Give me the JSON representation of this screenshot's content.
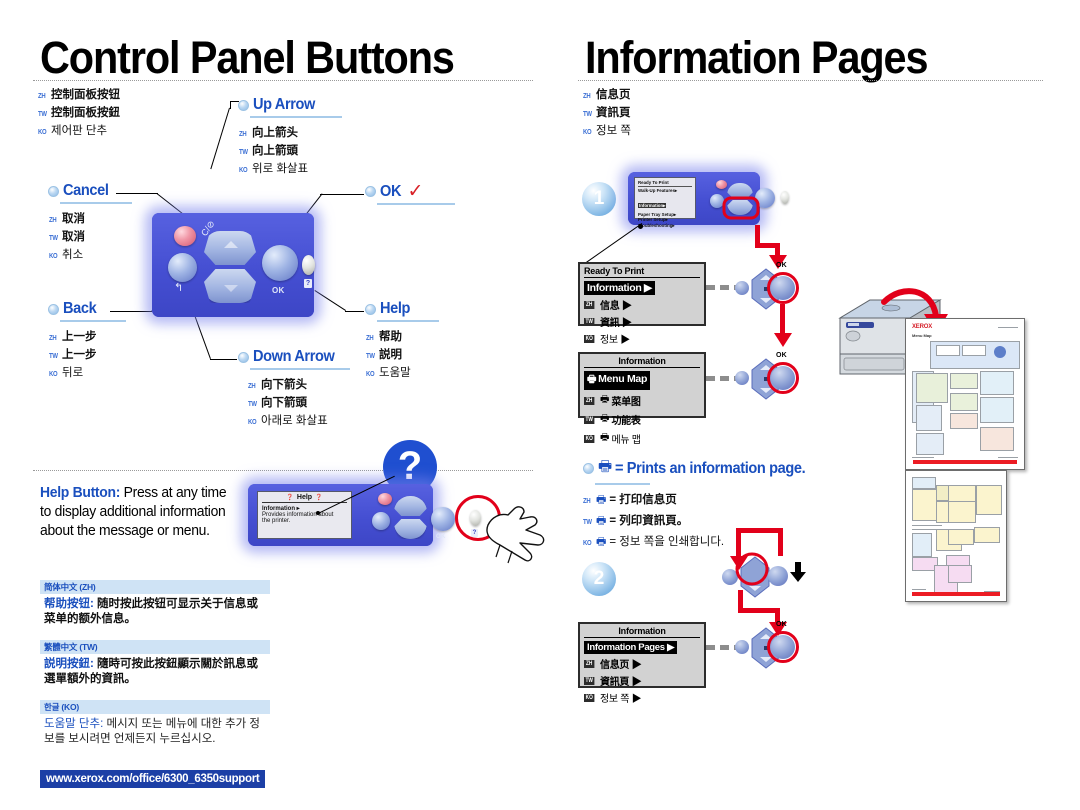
{
  "left_panel": {
    "heading": "Control Panel Buttons",
    "heading_langs": [
      {
        "tag": "ZH",
        "text": "控制面板按钮"
      },
      {
        "tag": "TW",
        "text": "控制面板按鈕"
      },
      {
        "tag": "KO",
        "text": "제어판 단추"
      }
    ],
    "callouts": [
      {
        "id": "up-arrow",
        "label": "Up Arrow",
        "check": false,
        "langs": [
          {
            "tag": "ZH",
            "text": "向上箭头"
          },
          {
            "tag": "TW",
            "text": "向上箭頭"
          },
          {
            "tag": "KO",
            "text": "위로 화살표"
          }
        ]
      },
      {
        "id": "cancel",
        "label": "Cancel",
        "check": false,
        "langs": [
          {
            "tag": "ZH",
            "text": "取消"
          },
          {
            "tag": "TW",
            "text": "取消"
          },
          {
            "tag": "KO",
            "text": "취소"
          }
        ]
      },
      {
        "id": "ok",
        "label": "OK",
        "check": true,
        "check_glyph": "✓",
        "langs": []
      },
      {
        "id": "back",
        "label": "Back",
        "check": false,
        "langs": [
          {
            "tag": "ZH",
            "text": "上一步"
          },
          {
            "tag": "TW",
            "text": "上一步"
          },
          {
            "tag": "KO",
            "text": "뒤로"
          }
        ]
      },
      {
        "id": "help",
        "label": "Help",
        "check": false,
        "langs": [
          {
            "tag": "ZH",
            "text": "帮助"
          },
          {
            "tag": "TW",
            "text": "説明"
          },
          {
            "tag": "KO",
            "text": "도움말"
          }
        ]
      },
      {
        "id": "down-arrow",
        "label": "Down Arrow",
        "check": false,
        "langs": [
          {
            "tag": "ZH",
            "text": "向下箭头"
          },
          {
            "tag": "TW",
            "text": "向下箭頭"
          },
          {
            "tag": "KO",
            "text": "아래로 화살표"
          }
        ]
      }
    ],
    "control_panel_art": {
      "ok_label": "OK",
      "back_glyph": "↰",
      "cancel_glyph": "C/⊘",
      "help_glyph": "?"
    },
    "help_note": {
      "bold": "Help Button:",
      "rest": " Press at any time to display additional information about the message or menu.",
      "icon": "?"
    },
    "help_lcd": {
      "title": "Help",
      "title_icon": "?",
      "line1": "Information ▸",
      "line2": "Provides information about",
      "line3": "the printer."
    },
    "lang_boxes": [
      {
        "id": "zh",
        "header": "简体中文 (ZH)",
        "lead": "帮助按钮:",
        "body": "随时按此按钮可显示关于信息或菜单的额外信息。"
      },
      {
        "id": "tw",
        "header": "繁體中文 (TW)",
        "lead": "説明按鈕:",
        "body": "隨時可按此按鈕顯示關於訊息或選單額外的資訊。"
      },
      {
        "id": "ko",
        "header": "한글 (KO)",
        "lead": "도움말 단추:",
        "body": "메시지 또는 메뉴에 대한 추가 정보를 보시려면 언제든지 누르십시오."
      }
    ],
    "url": "www.xerox.com/office/6300_6350support"
  },
  "right_panel": {
    "heading": "Information Pages",
    "heading_langs": [
      {
        "tag": "ZH",
        "text": "信息页"
      },
      {
        "tag": "TW",
        "text": "資訊頁"
      },
      {
        "tag": "KO",
        "text": "정보 쪽"
      }
    ],
    "step1": {
      "number": "1",
      "mini_lcd": [
        "Ready To Print",
        "Walk-Up Features▸",
        "Information▸",
        "Paper Tray Setup▸",
        "Printer Setup▸",
        "Troubleshooting▸"
      ],
      "lcd_a": {
        "title": "Ready To Print",
        "highlight": "Information ▶",
        "rows": [
          {
            "tag": "ZH",
            "text": "信息 ▶"
          },
          {
            "tag": "TW",
            "text": "資訊 ▶"
          },
          {
            "tag": "KO",
            "text": "정보 ▶"
          }
        ]
      },
      "lcd_b": {
        "title": "Information",
        "highlight": "Menu Map",
        "highlight_icon": "printer",
        "rows": [
          {
            "tag": "ZH",
            "text": "菜单图",
            "icon": "printer"
          },
          {
            "tag": "TW",
            "text": "功能表",
            "icon": "printer"
          },
          {
            "tag": "KO",
            "text": "메뉴 맵",
            "icon": "printer"
          }
        ]
      },
      "ok_cap": "OK"
    },
    "legend": {
      "icon": "printer",
      "label": "= Prints an information page.",
      "langs": [
        {
          "tag": "ZH",
          "text": "= 打印信息页"
        },
        {
          "tag": "TW",
          "text": "= 列印資訊頁。"
        },
        {
          "tag": "KO",
          "text": "= 정보 쪽을 인쇄합니다."
        }
      ]
    },
    "step2": {
      "number": "2",
      "lcd": {
        "title": "Information",
        "highlight": "Information Pages ▶",
        "rows": [
          {
            "tag": "ZH",
            "text": "信息页 ▶"
          },
          {
            "tag": "TW",
            "text": "資訊頁 ▶"
          },
          {
            "tag": "KO",
            "text": "정보 쪽 ▶"
          }
        ]
      },
      "ok_cap": "OK"
    },
    "output": {
      "sheet1_logo": "XEROX",
      "sheet1_title": "Menu Map"
    }
  },
  "colors": {
    "accent_blue": "#1a4fbe",
    "panel_blue": "#4a52d8",
    "red": "#e2001a",
    "url_bar": "#1c3fa6",
    "lang_head": "#cfe3f5"
  }
}
